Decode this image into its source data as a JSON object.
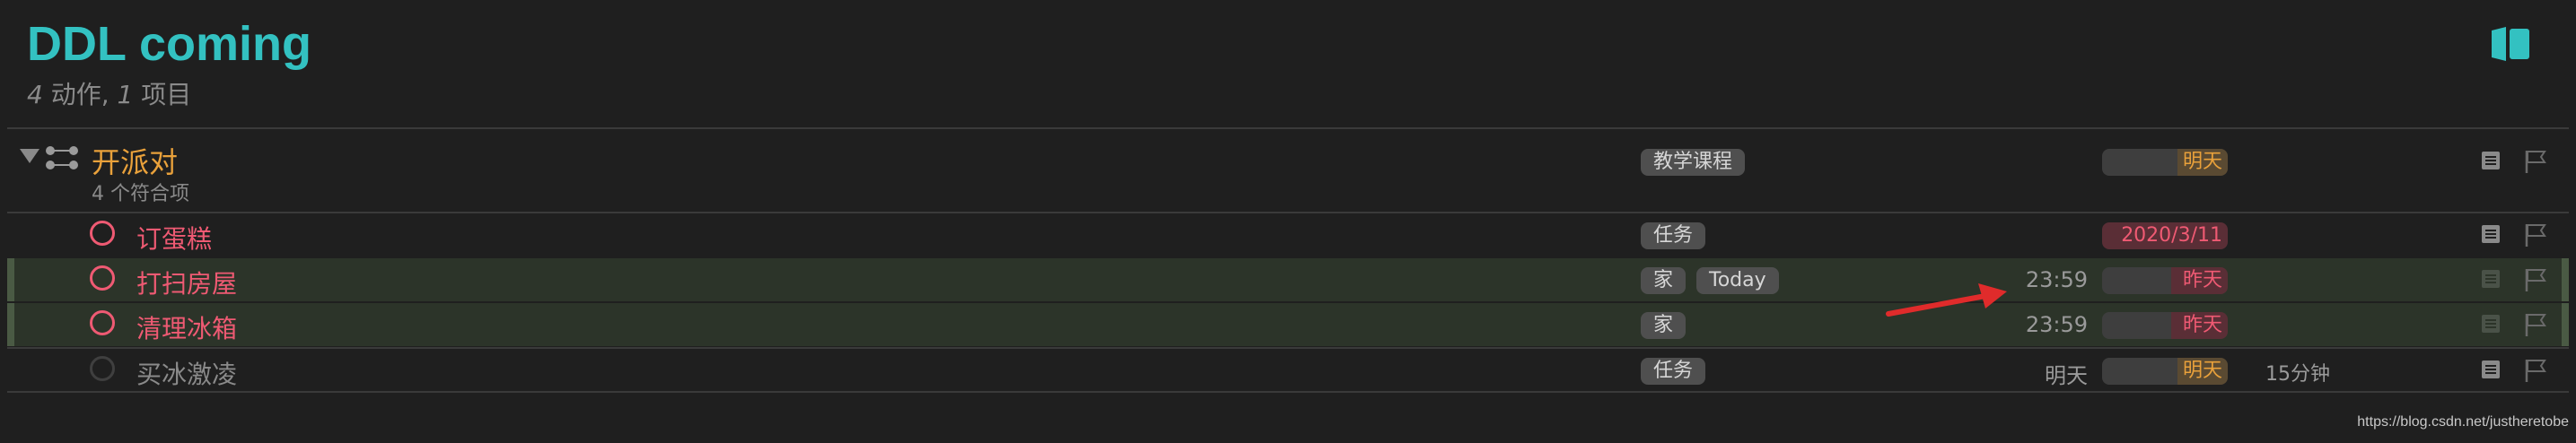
{
  "header": {
    "title": "DDL coming",
    "subtitle": {
      "count_actions": "4",
      "actions_label": " 动作, ",
      "count_projects": "1",
      "projects_label": " 项目"
    }
  },
  "project": {
    "title": "开派对",
    "subtitle": "4 个符合项",
    "tag": "教学课程",
    "due": "明天"
  },
  "tasks": [
    {
      "title": "订蛋糕",
      "tags": [
        "任务"
      ],
      "time": "",
      "due": "2020/3/11",
      "estimate": ""
    },
    {
      "title": "打扫房屋",
      "tags": [
        "家",
        "Today"
      ],
      "time": "23:59",
      "due": "昨天",
      "estimate": ""
    },
    {
      "title": "清理冰箱",
      "tags": [
        "家"
      ],
      "time": "23:59",
      "due": "昨天",
      "estimate": ""
    },
    {
      "title": "买冰激凌",
      "tags": [
        "任务"
      ],
      "time": "明天",
      "due": "明天",
      "estimate": "15分钟"
    }
  ],
  "watermark": "https://blog.csdn.net/justheretobe",
  "colors": {
    "accent": "#33c1c1",
    "project": "#e9a13b",
    "overdue": "#ef5a73",
    "background": "#1f1f1f"
  },
  "icons": {
    "disclosure": "triangle-down-icon",
    "project": "sequential-project-icon",
    "sidebar": "sidebar-toggle-icon",
    "note": "note-icon",
    "flag": "flag-icon"
  }
}
